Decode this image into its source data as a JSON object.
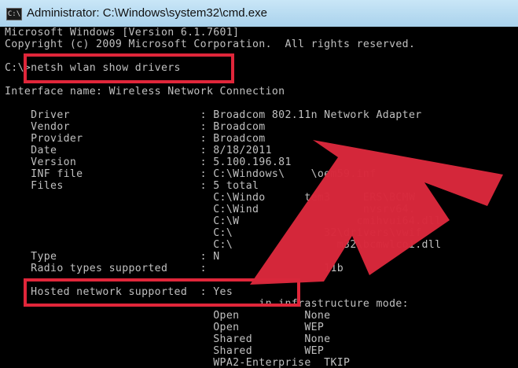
{
  "window": {
    "title": "Administrator: C:\\Windows\\system32\\cmd.exe",
    "icon": "cmd-icon",
    "icon_label": "C:\\"
  },
  "console": {
    "lines": [
      "Microsoft Windows [Version 6.1.7601]",
      "Copyright (c) 2009 Microsoft Corporation.  All rights reserved.",
      "",
      "C:\\>netsh wlan show drivers",
      "",
      "Interface name: Wireless Network Connection",
      "",
      "    Driver                    : Broadcom 802.11n Network Adapter",
      "    Vendor                    : Broadcom",
      "    Provider                  : Broadcom",
      "    Date                      : 8/18/2011",
      "    Version                   : 5.100.196.81",
      "    INF file                  : C:\\Windows\\    \\oem59.inf",
      "    Files                     : 5 total",
      "                                C:\\Windo      tem3     ERS\\BCMW",
      "                                C:\\Wind                nvsrv64.",
      "                                C:\\W                  cmihvui64.dll",
      "                                C:\\              32\\drivers\\vwif",
      "                                C:\\                m32\\bcmwlcoi.dll",
      "    Type                      : N",
      "    Radio types supported     :                  11b",
      "",
      "    Hosted network supported  : Yes",
      "                                       in infrastructure mode:",
      "                                Open          None",
      "                                Open          WEP",
      "                                Shared        None",
      "                                Shared        WEP",
      "                                WPA2-Enterprise  TKIP"
    ]
  },
  "highlights": [
    "command",
    "hosted-network-supported"
  ],
  "colors": {
    "console_text": "#c0c0c0",
    "highlight": "#e0263a",
    "arrow": "#d8283b"
  }
}
